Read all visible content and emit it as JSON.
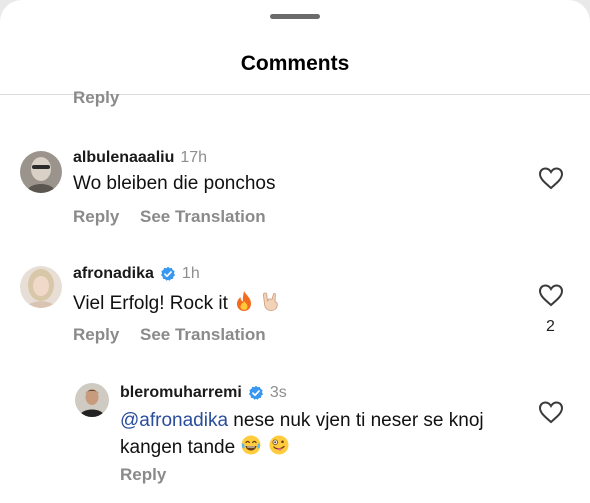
{
  "header": {
    "title": "Comments"
  },
  "top_reply": "Reply",
  "comments": [
    {
      "username": "albulenaaaliu",
      "time": "17h",
      "text": "Wo bleiben die ponchos",
      "reply_label": "Reply",
      "translate_label": "See Translation"
    },
    {
      "username": "afronadika",
      "time": "1h",
      "verified": true,
      "text": "Viel Erfolg! Rock it",
      "emoji": [
        "fire-emoji",
        "rock-hand-emoji"
      ],
      "reply_label": "Reply",
      "translate_label": "See Translation",
      "like_count": "2"
    }
  ],
  "reply": {
    "username": "bleromuharremi",
    "time": "3s",
    "verified": true,
    "mention": "@afronadika",
    "text_line1": " nese nuk vjen ti neser se knoj",
    "text_line2": "kangen tande",
    "emoji": [
      "tears-of-joy-emoji",
      "zany-face-emoji"
    ],
    "reply_label": "Reply"
  },
  "icons": {
    "like": "heart-outline-icon",
    "verified": "verified-badge-icon"
  },
  "colors": {
    "accent_blue": "#3897f0",
    "link_gray": "#8a8a8a",
    "mention": "#2a4d9b"
  }
}
